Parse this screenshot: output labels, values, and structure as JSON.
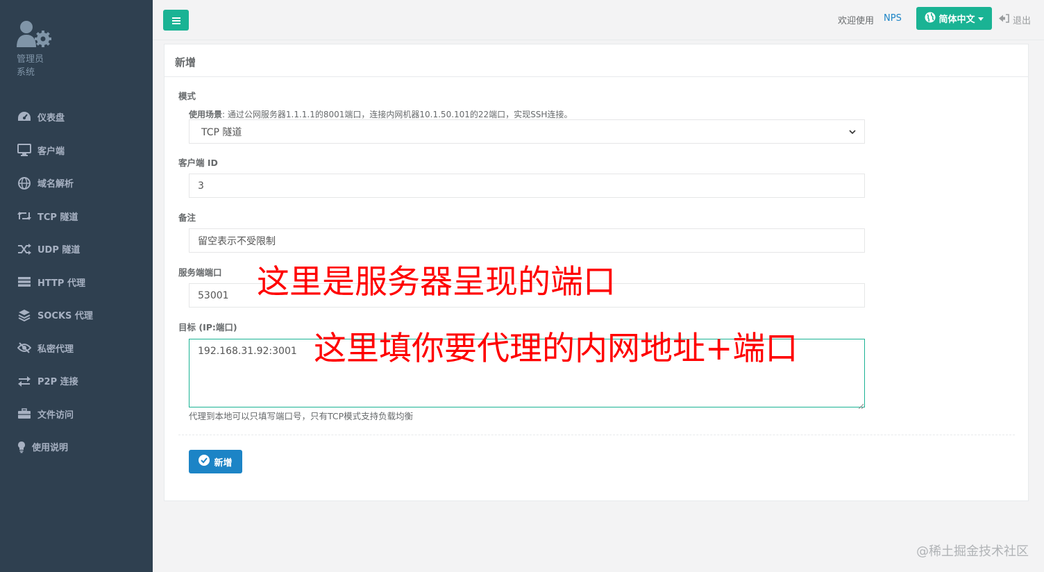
{
  "sidebar": {
    "profile": {
      "role": "管理员",
      "system": "系统",
      "icon": "user-gear-icon"
    },
    "items": [
      {
        "label": "仪表盘",
        "icon": "dashboard-icon"
      },
      {
        "label": "客户端",
        "icon": "monitor-icon"
      },
      {
        "label": "域名解析",
        "icon": "globe-icon"
      },
      {
        "label": "TCP 隧道",
        "icon": "retweet-icon"
      },
      {
        "label": "UDP 隧道",
        "icon": "shuffle-icon"
      },
      {
        "label": "HTTP 代理",
        "icon": "server-icon"
      },
      {
        "label": "SOCKS 代理",
        "icon": "layers-icon"
      },
      {
        "label": "私密代理",
        "icon": "eye-slash-icon"
      },
      {
        "label": "P2P 连接",
        "icon": "exchange-icon"
      },
      {
        "label": "文件访问",
        "icon": "briefcase-icon"
      },
      {
        "label": "使用说明",
        "icon": "lightbulb-icon"
      }
    ]
  },
  "topbar": {
    "welcome": "欢迎使用",
    "brand": "NPS",
    "language": "简体中文",
    "logout": "退出"
  },
  "form": {
    "title": "新增",
    "mode_label": "模式",
    "hint_bold": "使用场景",
    "hint_text": ": 通过公网服务器1.1.1.1的8001端口，连接内网机器10.1.50.101的22端口，实现SSH连接。",
    "mode_value": "TCP 隧道",
    "client_id_label": "客户端 ID",
    "client_id_value": "3",
    "remark_label": "备注",
    "remark_placeholder": "留空表示不受限制",
    "server_port_label": "服务端端口",
    "server_port_value": "53001",
    "target_label": "目标 (IP:端口)",
    "target_value": "192.168.31.92:3001",
    "target_help": "代理到本地可以只填写端口号，只有TCP模式支持负载均衡",
    "submit_label": "新增"
  },
  "annotations": {
    "port_note": "这里是服务器呈现的端口",
    "target_note": "这里填你要代理的内网地址+端口"
  },
  "watermark": "@稀土掘金技术社区",
  "colors": {
    "sidebar": "#2f4050",
    "primary": "#1ab394",
    "blue": "#1c84c6",
    "annotation": "#ff0000"
  }
}
